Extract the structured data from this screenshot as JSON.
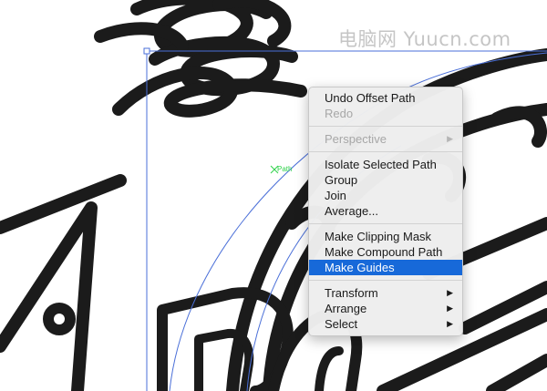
{
  "watermark": "电脑网 Yuucn.com",
  "canvas": {
    "anchor_label": "Path",
    "stroke_color": "#1b1b1b",
    "selection_color": "#4a6fd8"
  },
  "context_menu": {
    "highlight_color": "#1769d9",
    "items": [
      {
        "label": "Undo Offset Path",
        "disabled": false
      },
      {
        "label": "Redo",
        "disabled": true
      },
      {
        "label": "Perspective",
        "disabled": true,
        "submenu": true
      },
      {
        "label": "Isolate Selected Path",
        "disabled": false
      },
      {
        "label": "Group",
        "disabled": false
      },
      {
        "label": "Join",
        "disabled": false
      },
      {
        "label": "Average...",
        "disabled": false
      },
      {
        "label": "Make Clipping Mask",
        "disabled": false
      },
      {
        "label": "Make Compound Path",
        "disabled": false
      },
      {
        "label": "Make Guides",
        "disabled": false,
        "highlighted": true
      },
      {
        "label": "Transform",
        "disabled": false,
        "submenu": true
      },
      {
        "label": "Arrange",
        "disabled": false,
        "submenu": true
      },
      {
        "label": "Select",
        "disabled": false,
        "submenu": true
      }
    ]
  }
}
